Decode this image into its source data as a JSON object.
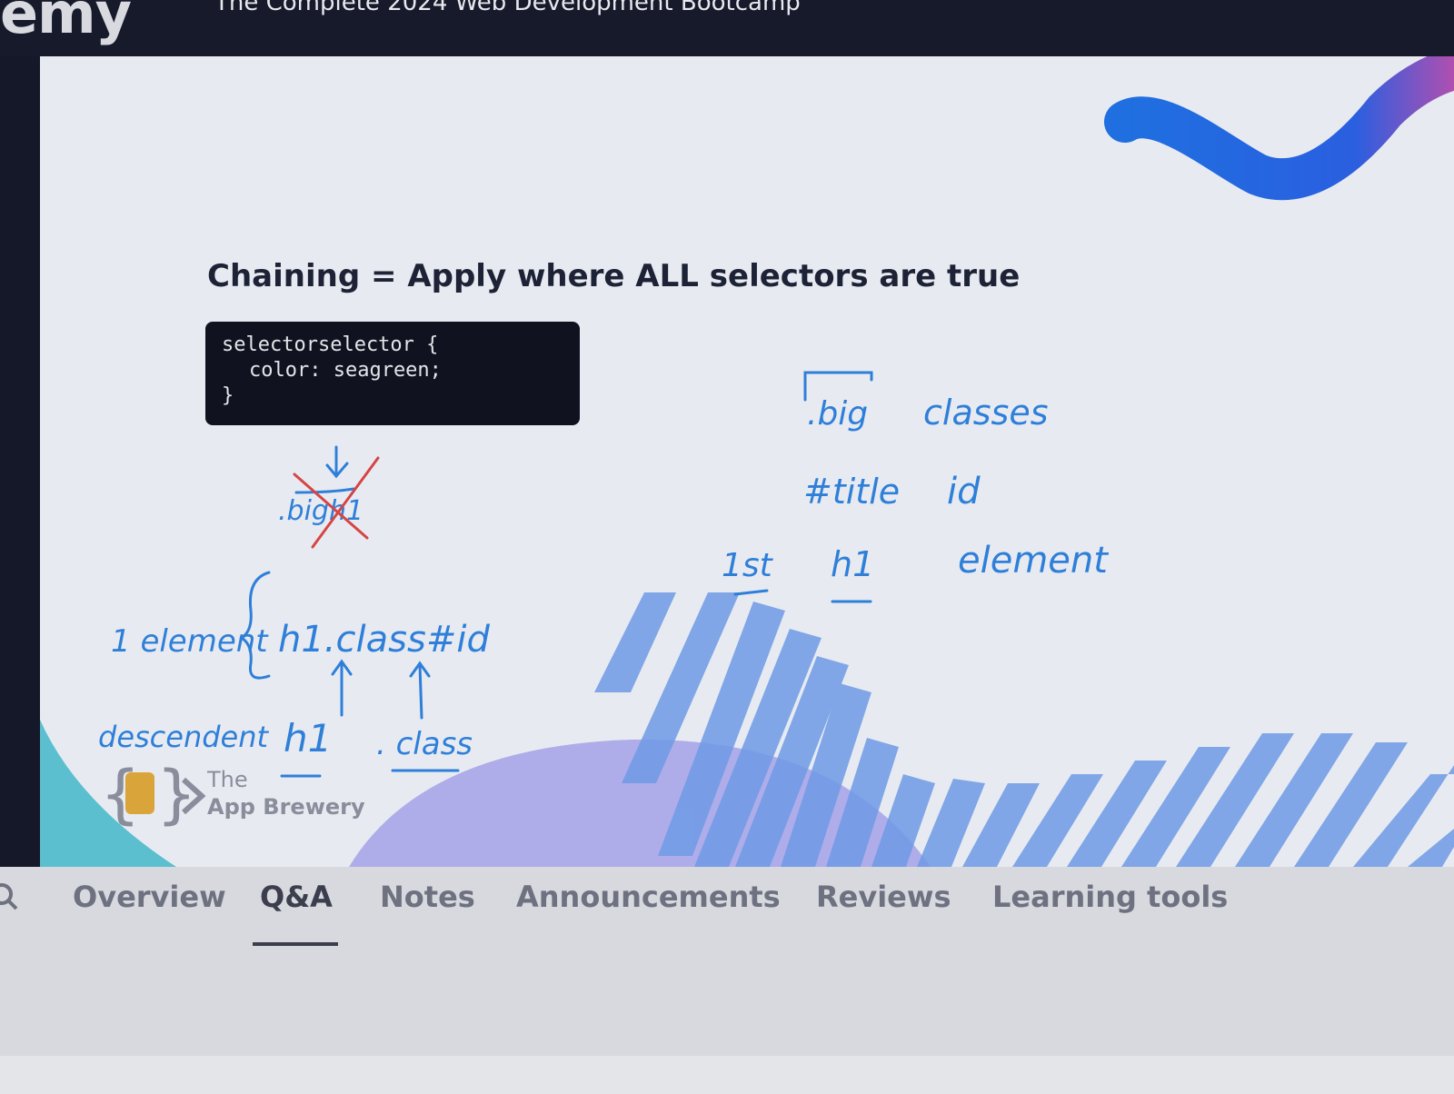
{
  "header": {
    "logo_text": "emy",
    "course_title": "The Complete 2024 Web Development Bootcamp"
  },
  "slide": {
    "title": "Chaining  = Apply where ALL selectors are true",
    "code": {
      "line1": "selectorselector {",
      "line2": "color: seagreen;",
      "line3": "}"
    },
    "brand": {
      "line1": "The",
      "line2": "App Brewery"
    },
    "handwritten_notes": {
      "crossed": ".bigh1",
      "rule": "1 element",
      "chain": "h1.class#id",
      "descendant_label": "descendent",
      "desc_h1": "h1",
      "desc_class": ". class",
      "big": ".big",
      "classes": "classes",
      "title": "#title",
      "id": "id",
      "first": "1st",
      "h1": "h1",
      "element": "element"
    }
  },
  "tabs": {
    "items": [
      "Overview",
      "Q&A",
      "Notes",
      "Announcements",
      "Reviews",
      "Learning tools"
    ],
    "active": "Q&A"
  },
  "colors": {
    "ink_blue": "#2f7fd9",
    "ink_red": "#d64545",
    "wave_blue": "#1f6fe0",
    "stripe_blue": "#6f9be6",
    "purple_mound": "#a8a6e8",
    "teal_corner": "#5bbfcf"
  }
}
